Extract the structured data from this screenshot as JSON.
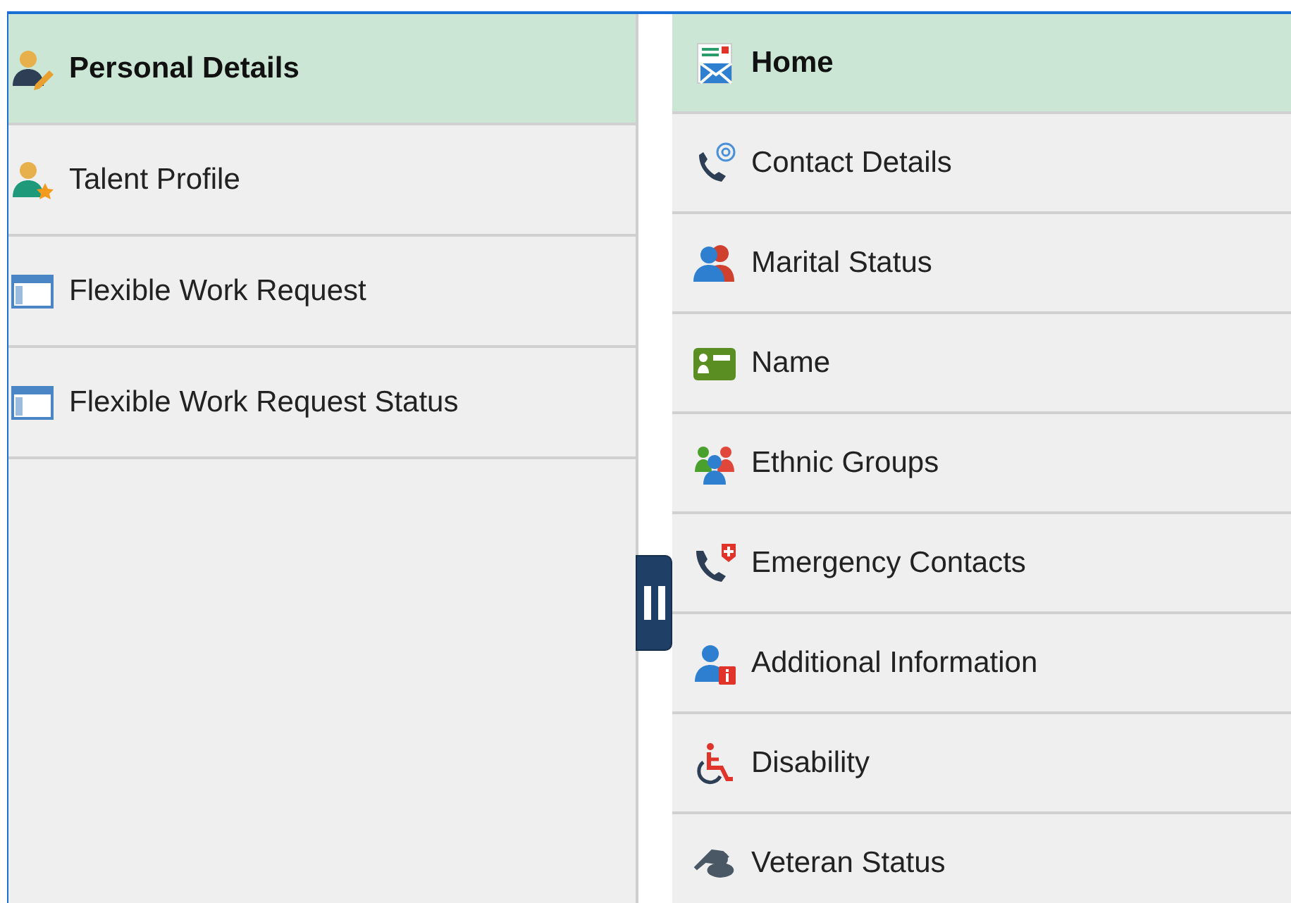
{
  "left_menu": {
    "items": [
      {
        "label": "Personal Details",
        "selected": true
      },
      {
        "label": "Talent Profile",
        "selected": false
      },
      {
        "label": "Flexible Work Request",
        "selected": false
      },
      {
        "label": "Flexible Work Request Status",
        "selected": false
      }
    ]
  },
  "right_menu": {
    "items": [
      {
        "label": "Home",
        "selected": true
      },
      {
        "label": "Contact Details",
        "selected": false
      },
      {
        "label": "Marital Status",
        "selected": false
      },
      {
        "label": "Name",
        "selected": false
      },
      {
        "label": "Ethnic Groups",
        "selected": false
      },
      {
        "label": "Emergency Contacts",
        "selected": false
      },
      {
        "label": "Additional Information",
        "selected": false
      },
      {
        "label": "Disability",
        "selected": false
      },
      {
        "label": "Veteran Status",
        "selected": false
      }
    ]
  }
}
